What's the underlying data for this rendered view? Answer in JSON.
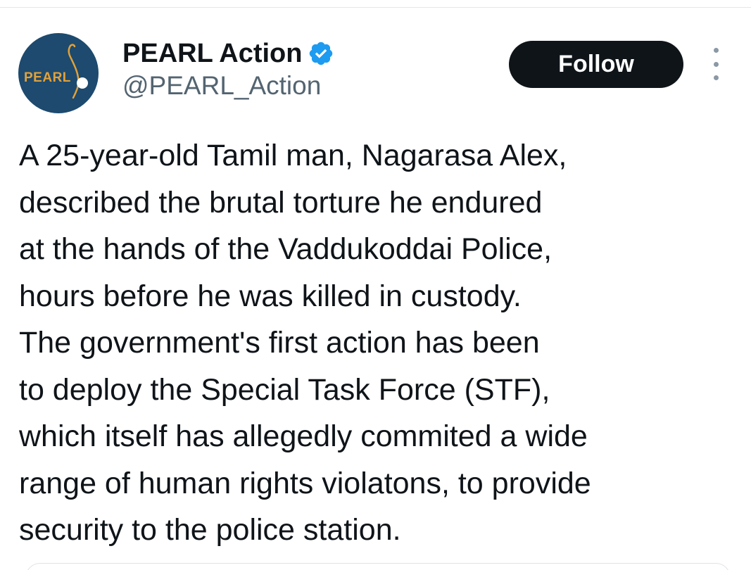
{
  "author": {
    "display_name": "PEARL Action",
    "handle": "@PEARL_Action",
    "avatar_text": "PEARL",
    "verified": true
  },
  "actions": {
    "follow_label": "Follow"
  },
  "tweet": {
    "lines": [
      "A 25-year-old Tamil man, Nagarasa Alex,",
      "described the brutal torture he endured",
      "at the hands of the Vaddukoddai Police,",
      "hours before he was killed in custody.",
      "The government's first action has been",
      "to deploy the Special Task Force (STF),",
      "which itself has allegedly commited a wide",
      "range of human rights violatons, to provide",
      "security to the police station."
    ]
  },
  "colors": {
    "text_primary": "#0f1419",
    "text_secondary": "#536471",
    "verified_blue": "#1d9bf0",
    "avatar_bg": "#1d4a6e",
    "avatar_accent": "#e2a13a",
    "follow_bg": "#0f1419"
  },
  "icons": {
    "verified": "verified-badge-icon",
    "more": "more-vertical-icon"
  }
}
